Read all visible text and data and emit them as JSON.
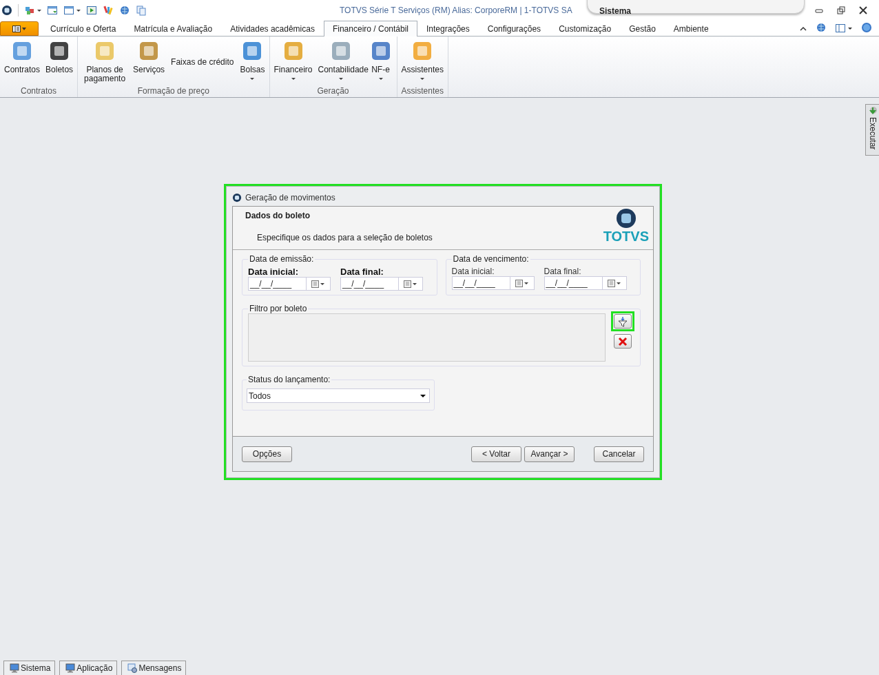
{
  "window": {
    "title": "TOTVS Série T Serviços (RM) Alias: CorporeRM | 1-TOTVS SA",
    "context": "Sistema"
  },
  "tabs": [
    {
      "label": "Currículo e Oferta",
      "selected": false
    },
    {
      "label": "Matrícula e Avaliação",
      "selected": false
    },
    {
      "label": "Atividades acadêmicas",
      "selected": false
    },
    {
      "label": "Financeiro / Contábil",
      "selected": true
    },
    {
      "label": "Integrações",
      "selected": false
    },
    {
      "label": "Configurações",
      "selected": false
    },
    {
      "label": "Customização",
      "selected": false
    },
    {
      "label": "Gestão",
      "selected": false
    },
    {
      "label": "Ambiente",
      "selected": false
    }
  ],
  "ribbon_groups": [
    {
      "label": "Contratos",
      "items": [
        {
          "label": "Contratos",
          "kind": "large",
          "dropdown": false
        },
        {
          "label": "Boletos",
          "kind": "large",
          "dropdown": false
        }
      ]
    },
    {
      "label": "Formação de preço",
      "items": [
        {
          "label": "Planos de pagamento",
          "kind": "large",
          "dropdown": false
        },
        {
          "label": "Serviços",
          "kind": "large",
          "dropdown": false
        },
        {
          "label": "Faixas de crédito",
          "kind": "text",
          "dropdown": false
        },
        {
          "label": "Bolsas",
          "kind": "large",
          "dropdown": true
        }
      ]
    },
    {
      "label": "Geração",
      "items": [
        {
          "label": "Financeiro",
          "kind": "large",
          "dropdown": true
        },
        {
          "label": "Contabilidade",
          "kind": "large",
          "dropdown": true
        },
        {
          "label": "NF-e",
          "kind": "large",
          "dropdown": true
        }
      ]
    },
    {
      "label": "Assistentes",
      "items": [
        {
          "label": "Assistentes",
          "kind": "large",
          "dropdown": true
        }
      ]
    }
  ],
  "side_panel": {
    "label": "Executar"
  },
  "dialog": {
    "title": "Geração de movimentos",
    "highlighted": true,
    "heading": "Dados do boleto",
    "subtitle": "Especifique os dados para a seleção de boletos",
    "logo": "TOTVS",
    "date_groups": [
      {
        "label": "Data de emissão:",
        "fields": [
          {
            "label": "Data inicial:",
            "value": "__/__/____",
            "emphasized": true
          },
          {
            "label": "Data final:",
            "value": "__/__/____",
            "emphasized": true
          }
        ]
      },
      {
        "label": "Data de vencimento:",
        "fields": [
          {
            "label": "Data inicial:",
            "value": "__/__/____",
            "emphasized": false
          },
          {
            "label": "Data final:",
            "value": "__/__/____",
            "emphasized": false
          }
        ]
      }
    ],
    "filter": {
      "label": "Filtro por boleto",
      "filter_button_highlighted": true
    },
    "status": {
      "label": "Status do lançamento:",
      "value": "Todos"
    },
    "buttons": {
      "options": "Opções",
      "back": "< Voltar",
      "next": "Avançar >",
      "cancel": "Cancelar"
    }
  },
  "taskbar": [
    {
      "label": "Sistema",
      "kind": "monitor"
    },
    {
      "label": "Aplicação",
      "kind": "monitor"
    },
    {
      "label": "Mensagens",
      "kind": "messages"
    }
  ]
}
